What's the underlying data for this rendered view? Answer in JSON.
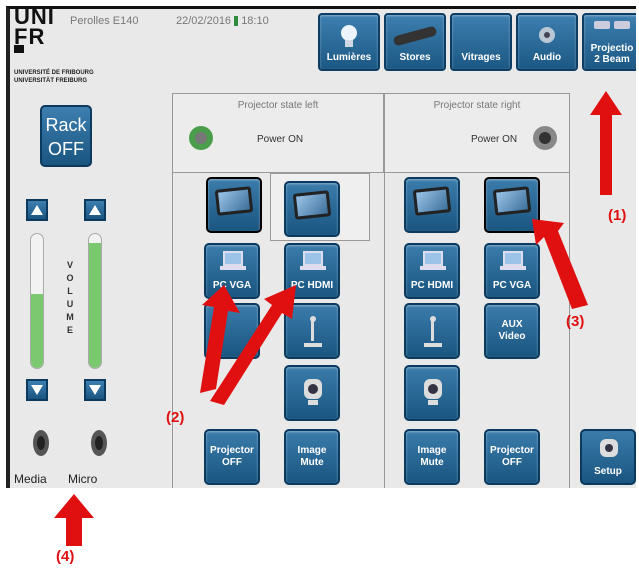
{
  "header": {
    "logo_line1": "UNI",
    "logo_line2": "FR",
    "university_fr": "UNIVERSITÉ DE FRIBOURG",
    "university_de": "UNIVERSITÄT FREIBURG",
    "room": "Perolles E140",
    "date": "22/02/2016",
    "time": "18:10"
  },
  "top_buttons": [
    {
      "label": "Lumières",
      "icon": "lightbulb-icon"
    },
    {
      "label": "Stores",
      "icon": "blinds-icon"
    },
    {
      "label": "Vitrages",
      "icon": "window-icon"
    },
    {
      "label": "Audio",
      "icon": "audio-icon"
    },
    {
      "label_line1": "Projectio",
      "label_line2": "2 Beam",
      "icon": "projector-icon"
    }
  ],
  "rack": {
    "line1": "Rack",
    "line2": "OFF"
  },
  "volume": {
    "letters": [
      "V",
      "O",
      "L",
      "U",
      "M",
      "E"
    ],
    "media_level": 0.55,
    "micro_level": 0.93,
    "media_label": "Media",
    "micro_label": "Micro"
  },
  "left_panel": {
    "title": "Projector state left",
    "power": "Power ON",
    "inputs": [
      "PC VGA",
      "PC HDMI"
    ],
    "projector_off": [
      "Projector",
      "OFF"
    ],
    "image_mute": [
      "Image",
      "Mute"
    ]
  },
  "right_panel": {
    "title": "Projector state right",
    "power": "Power ON",
    "inputs": [
      "PC HDMI",
      "PC VGA"
    ],
    "aux": [
      "AUX",
      "Video"
    ],
    "image_mute": [
      "Image",
      "Mute"
    ],
    "projector_off": [
      "Projector",
      "OFF"
    ]
  },
  "setup_label": "Setup",
  "annotations": {
    "a1": "(1)",
    "a2": "(2)",
    "a3": "(3)",
    "a4": "(4)"
  },
  "colors": {
    "tile": "#1f5f8b",
    "arrow": "#e01010",
    "volume_fill": "#7bc96f"
  }
}
